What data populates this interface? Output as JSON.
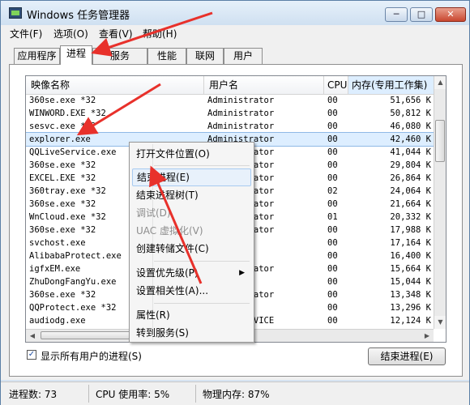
{
  "window": {
    "title": "Windows 任务管理器",
    "controls": {
      "minimize": "─",
      "maximize": "□",
      "close": "✕"
    }
  },
  "menu": [
    "文件(F)",
    "选项(O)",
    "查看(V)",
    "帮助(H)"
  ],
  "tabs": [
    "应用程序",
    "进程",
    "服务",
    "性能",
    "联网",
    "用户"
  ],
  "columns": [
    "映像名称",
    "用户名",
    "CPU",
    "内存(专用工作集)"
  ],
  "rows": [
    {
      "name": "360se.exe *32",
      "user": "Administrator",
      "cpu": "00",
      "mem": "51,656 K"
    },
    {
      "name": "WINWORD.EXE *32",
      "user": "Administrator",
      "cpu": "00",
      "mem": "50,812 K"
    },
    {
      "name": "sesvc.exe *32",
      "user": "Administrator",
      "cpu": "00",
      "mem": "46,080 K"
    },
    {
      "name": "explorer.exe",
      "user": "Administrator",
      "cpu": "00",
      "mem": "42,460 K"
    },
    {
      "name": "QQLiveService.exe",
      "user": "Administrator",
      "cpu": "00",
      "mem": "41,044 K"
    },
    {
      "name": "360se.exe *32",
      "user": "Administrator",
      "cpu": "00",
      "mem": "29,804 K"
    },
    {
      "name": "EXCEL.EXE *32",
      "user": "Administrator",
      "cpu": "00",
      "mem": "26,864 K"
    },
    {
      "name": "360tray.exe *32",
      "user": "Administrator",
      "cpu": "02",
      "mem": "24,064 K"
    },
    {
      "name": "360se.exe *32",
      "user": "Administrator",
      "cpu": "00",
      "mem": "21,664 K"
    },
    {
      "name": "WnCloud.exe *32",
      "user": "Administrator",
      "cpu": "01",
      "mem": "20,332 K"
    },
    {
      "name": "360se.exe *32",
      "user": "Administrator",
      "cpu": "00",
      "mem": "17,988 K"
    },
    {
      "name": "svchost.exe",
      "user": "",
      "cpu": "00",
      "mem": "17,164 K"
    },
    {
      "name": "AlibabaProtect.exe",
      "user": "",
      "cpu": "00",
      "mem": "16,400 K"
    },
    {
      "name": "igfxEM.exe",
      "user": "Administrator",
      "cpu": "00",
      "mem": "15,664 K"
    },
    {
      "name": "ZhuDongFangYu.exe",
      "user": "",
      "cpu": "00",
      "mem": "15,044 K"
    },
    {
      "name": "360se.exe *32",
      "user": "Administrator",
      "cpu": "00",
      "mem": "13,348 K"
    },
    {
      "name": "QQProtect.exe *32",
      "user": "",
      "cpu": "00",
      "mem": "13,296 K"
    },
    {
      "name": "audiodg.exe",
      "user": "LOCAL SERVICE",
      "cpu": "00",
      "mem": "12,124 K"
    }
  ],
  "context_menu": [
    {
      "label": "打开文件位置(O)",
      "disabled": false
    },
    {
      "label": "结束进程(E)",
      "disabled": false
    },
    {
      "label": "结束进程树(T)",
      "disabled": false
    },
    {
      "label": "调试(D)",
      "disabled": true
    },
    {
      "label": "UAC 虚拟化(V)",
      "disabled": true
    },
    {
      "label": "创建转储文件(C)",
      "disabled": false
    },
    {
      "label": "设置优先级(P)",
      "disabled": false,
      "submenu": "▶"
    },
    {
      "label": "设置相关性(A)...",
      "disabled": false
    },
    {
      "label": "属性(R)",
      "disabled": false
    },
    {
      "label": "转到服务(S)",
      "disabled": false
    }
  ],
  "show_all_users": {
    "label": "显示所有用户的进程(S)",
    "checked": "✓"
  },
  "end_process_button": "结束进程(E)",
  "status": {
    "processes": "进程数: 73",
    "cpu": "CPU 使用率: 5%",
    "memory": "物理内存: 87%"
  },
  "colors": {
    "annotation_arrow": "#e8312b",
    "selection": "#ddeeff"
  }
}
